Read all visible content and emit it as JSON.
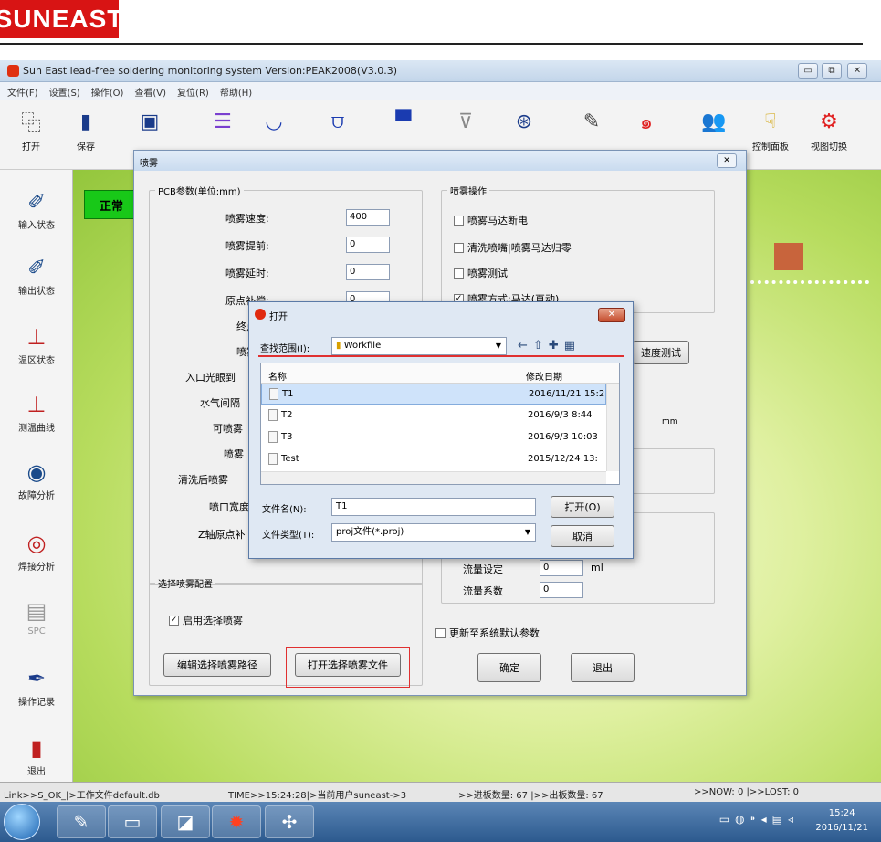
{
  "brand": {
    "logo": "SUNEAST"
  },
  "window": {
    "title": "Sun East lead-free soldering monitoring system Version:PEAK2008(V3.0.3)",
    "minimize": "▭",
    "restore": "⧉",
    "close": "✕"
  },
  "menu": [
    "文件(F)",
    "设置(S)",
    "操作(O)",
    "查看(V)",
    "复位(R)",
    "帮助(H)"
  ],
  "toolbar": [
    {
      "label": "打开",
      "icon": "open-icon",
      "glyph": "⿻"
    },
    {
      "label": "保存",
      "icon": "save-icon",
      "glyph": "▮"
    },
    {
      "label": "",
      "icon": "save-as-icon",
      "glyph": "▣"
    },
    {
      "label": "",
      "icon": "conveyor-icon",
      "glyph": "☰"
    },
    {
      "label": "",
      "icon": "wave1-icon",
      "glyph": "◡"
    },
    {
      "label": "",
      "icon": "wave2-icon",
      "glyph": "⩌"
    },
    {
      "label": "",
      "icon": "tank-icon",
      "glyph": "▀"
    },
    {
      "label": "",
      "icon": "flux-icon",
      "glyph": "⊽"
    },
    {
      "label": "",
      "icon": "globe-icon",
      "glyph": "⊛"
    },
    {
      "label": "",
      "icon": "tools-icon",
      "glyph": "✎"
    },
    {
      "label": "",
      "icon": "spiral-icon",
      "glyph": "๑"
    },
    {
      "label": "",
      "icon": "users-icon",
      "glyph": "👥"
    },
    {
      "label": "控制面板",
      "icon": "control-panel-icon",
      "glyph": "☟"
    },
    {
      "label": "视图切换",
      "icon": "view-switch-icon",
      "glyph": "⚙"
    }
  ],
  "sidebar": [
    {
      "label": "输入状态",
      "icon": "input-status-icon",
      "glyph": "✐"
    },
    {
      "label": "输出状态",
      "icon": "output-status-icon",
      "glyph": "✐"
    },
    {
      "label": "温区状态",
      "icon": "temp-zone-icon",
      "glyph": "⊥"
    },
    {
      "label": "测温曲线",
      "icon": "temp-curve-icon",
      "glyph": "⊥"
    },
    {
      "label": "故障分析",
      "icon": "fault-analysis-icon",
      "glyph": "◉"
    },
    {
      "label": "焊接分析",
      "icon": "weld-analysis-icon",
      "glyph": "◎"
    },
    {
      "label": "SPC",
      "icon": "spc-icon",
      "glyph": "▤"
    },
    {
      "label": "操作记录",
      "icon": "log-icon",
      "glyph": "✒"
    },
    {
      "label": "退出",
      "icon": "exit-icon",
      "glyph": "▮"
    }
  ],
  "status_indicator": "正常",
  "statusbar": {
    "file": "Link>>S_OK_|>工作文件default.db",
    "time": "TIME>>15:24:28|>当前用户suneast->3",
    "in_count": ">>进板数量: 67 |>>出板数量: 67",
    "now": ">>NOW: 0 |>>LOST: 0"
  },
  "taskbar": {
    "time": "15:24",
    "date": "2016/11/21"
  },
  "spray_dialog": {
    "title": "喷雾",
    "close": "✕",
    "pcb_group": "PCB参数(单位:mm)",
    "fields": [
      {
        "label": "喷雾速度:",
        "value": "400"
      },
      {
        "label": "喷雾提前:",
        "value": "0"
      },
      {
        "label": "喷雾延时:",
        "value": "0"
      },
      {
        "label": "原点补偿:",
        "value": "0"
      },
      {
        "label": "终点",
        "value": ""
      },
      {
        "label": "喷雾",
        "value": ""
      }
    ],
    "more_labels": [
      "入口光眼到",
      "水气间隔",
      "可喷雾",
      "喷雾",
      "清洗后喷雾",
      "喷口宽度",
      "Z轴原点补"
    ],
    "ops_group": "喷雾操作",
    "ops": [
      "喷雾马达断电",
      "清洗喷嘴|喷雾马达归零",
      "喷雾测试",
      "喷雾方式:马达(直动)"
    ],
    "speed_test": "速度测试",
    "unit_mm": "mm",
    "flow_label1": "流量设定",
    "flow_value1": "0",
    "flow_unit": "ml",
    "flow_label2": "流量系数",
    "flow_value2": "0",
    "select_group": "选择喷雾配置",
    "enable_select": "启用选择喷雾",
    "edit_path": "编辑选择喷雾路径",
    "open_file": "打开选择喷雾文件",
    "update_default": "更新至系统默认参数",
    "ok": "确定",
    "exit": "退出"
  },
  "open_dialog": {
    "title": "打开",
    "close": "✕",
    "lookin_label": "查找范围(I):",
    "lookin_value": "Workfile",
    "col_name": "名称",
    "col_date": "修改日期",
    "files": [
      {
        "name": "T1",
        "date": "2016/11/21 15:2"
      },
      {
        "name": "T2",
        "date": "2016/9/3 8:44"
      },
      {
        "name": "T3",
        "date": "2016/9/3 10:03"
      },
      {
        "name": "Test",
        "date": "2015/12/24 13:"
      }
    ],
    "filename_label": "文件名(N):",
    "filename_value": "T1",
    "filetype_label": "文件类型(T):",
    "filetype_value": "proj文件(*.proj)",
    "open_btn": "打开(O)",
    "cancel_btn": "取消"
  }
}
